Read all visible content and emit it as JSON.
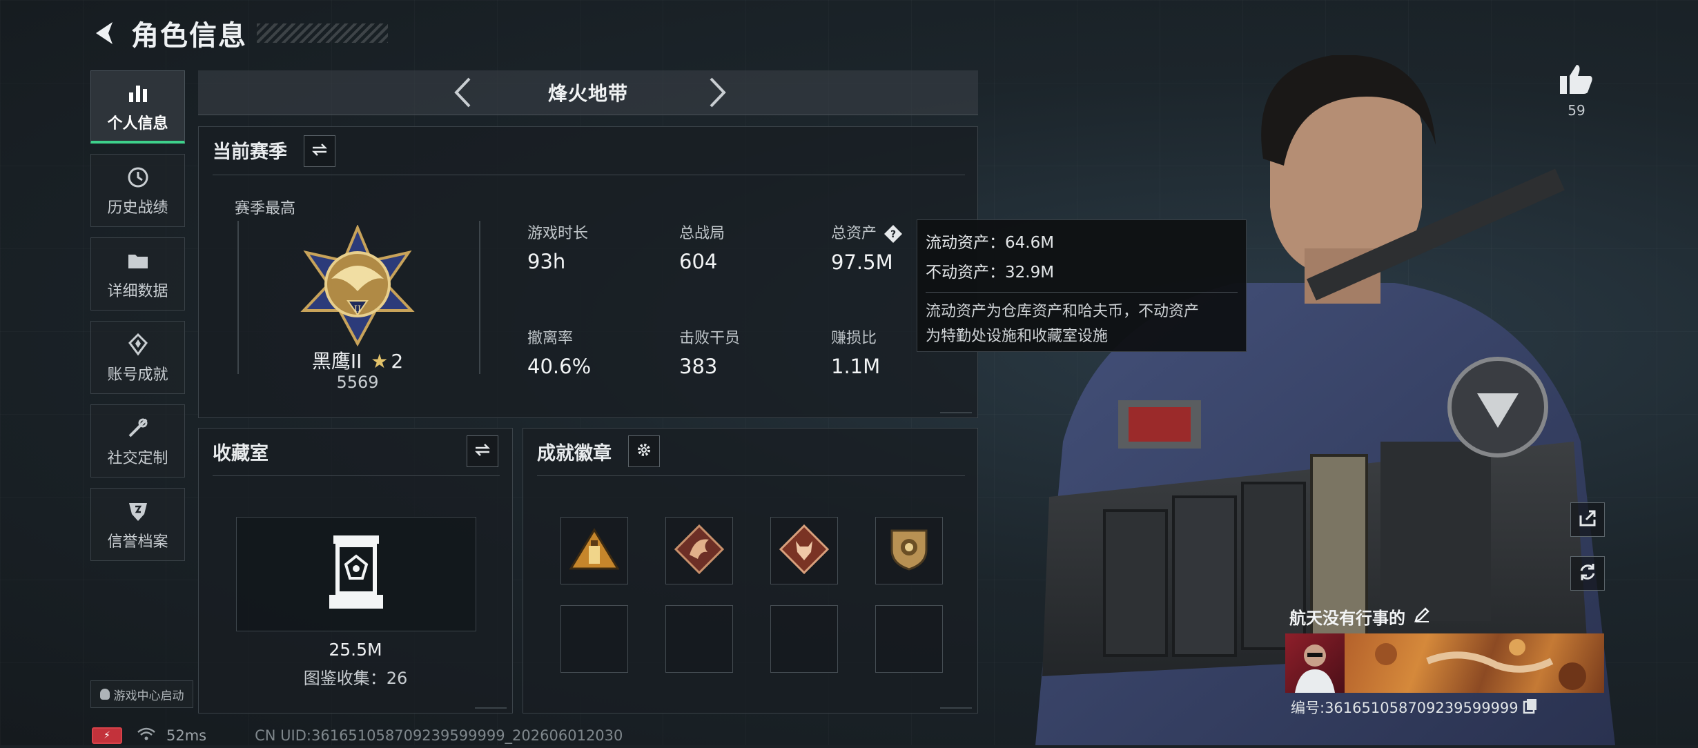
{
  "header": {
    "title": "角色信息"
  },
  "sidebar": {
    "items": [
      {
        "label": "个人信息",
        "icon": "bar-chart-icon",
        "active": true
      },
      {
        "label": "历史战绩",
        "icon": "history-icon",
        "active": false
      },
      {
        "label": "详细数据",
        "icon": "folder-icon",
        "active": false
      },
      {
        "label": "账号成就",
        "icon": "achievement-icon",
        "active": false
      },
      {
        "label": "社交定制",
        "icon": "tools-icon",
        "active": false
      },
      {
        "label": "信誉档案",
        "icon": "credit-shield-icon",
        "active": false
      }
    ],
    "launch_label": "游戏中心启动"
  },
  "mode": {
    "title": "烽火地带"
  },
  "season": {
    "title": "当前赛季",
    "best_label": "赛季最高",
    "rank_name": "黑鹰II",
    "rank_stars": "2",
    "rank_score": "5569",
    "stats": [
      {
        "label": "游戏时长",
        "value": "93h"
      },
      {
        "label": "总战局",
        "value": "604"
      },
      {
        "label": "总资产",
        "value": "97.5M"
      },
      {
        "label": "撤离率",
        "value": "40.6%"
      },
      {
        "label": "击败干员",
        "value": "383"
      },
      {
        "label": "赚损比",
        "value": "1.1M"
      }
    ]
  },
  "tooltip": {
    "liquid": "流动资产：64.6M",
    "fixed": "不动资产：32.9M",
    "desc_line1": "流动资产为仓库资产和哈夫币，不动资产",
    "desc_line2": "为特勤处设施和收藏室设施"
  },
  "collection": {
    "title": "收藏室",
    "value": "25.5M",
    "count": "图鉴收集：26"
  },
  "badges": {
    "title": "成就徽章",
    "items": [
      "pyramid-badge-icon",
      "dragon-badge-icon",
      "wolf-badge-icon",
      "lion-shield-badge-icon"
    ]
  },
  "profile": {
    "likes": "59",
    "nickname": "航天没有行事的",
    "uid": "编号:361651058709239599999"
  },
  "status": {
    "ping": "52ms",
    "uid_footer": "CN UID:361651058709239599999_202606012030"
  },
  "colors": {
    "accent": "#3ed18b",
    "panel_bg": "#181e22",
    "battery": "#c3323b"
  }
}
